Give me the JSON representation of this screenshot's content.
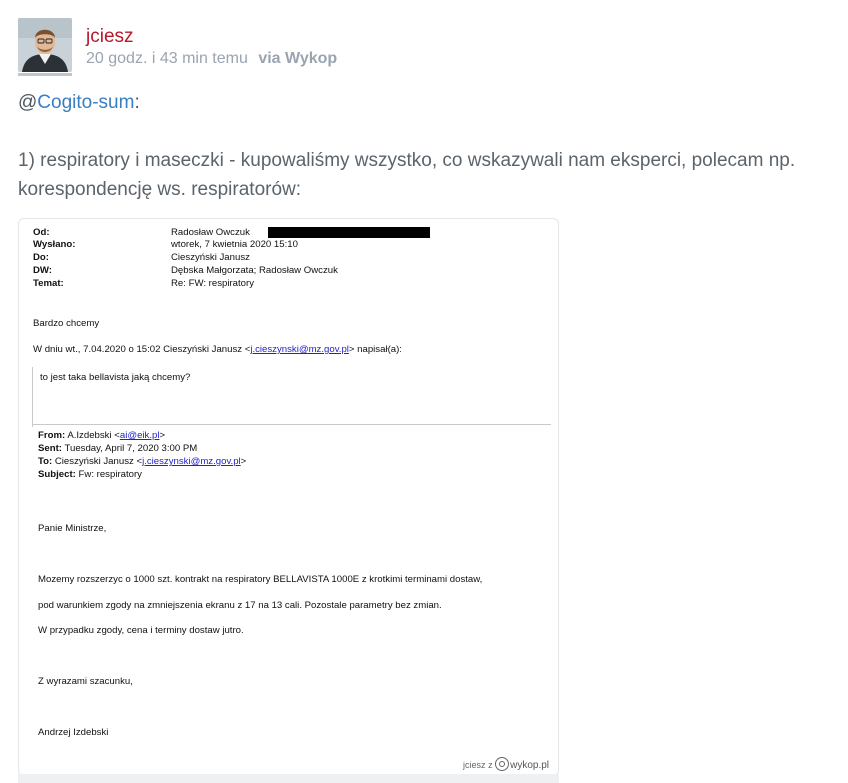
{
  "header": {
    "username": "jciesz",
    "time_ago": "20 godz. i 43 min temu",
    "via_label": "via",
    "via_source": "Wykop"
  },
  "post": {
    "mention_prefix": "@",
    "mention_user": "Cogito-sum",
    "mention_suffix": ":",
    "text": "1) respiratory i maseczki - kupowaliśmy wszystko, co wskazywali nam eksperci, polecam np. korespondencję ws. respiratorów:"
  },
  "email": {
    "headers": [
      {
        "label": "Od:",
        "value": "Radosław Owczuk"
      },
      {
        "label": "Wysłano:",
        "value": "wtorek, 7 kwietnia 2020 15:10"
      },
      {
        "label": "Do:",
        "value": "Cieszyński Janusz"
      },
      {
        "label": "DW:",
        "value": "Dębska Małgorzata; Radosław Owczuk"
      },
      {
        "label": "Temat:",
        "value": "Re: FW: respiratory"
      }
    ],
    "reply": "Bardzo chcemy",
    "quote_intro_prefix": "W dniu wt., 7.04.2020 o 15:02 Cieszyński Janusz <",
    "quote_intro_email": "j.cieszynski@mz.gov.pl",
    "quote_intro_suffix": "> napisał(a):",
    "quoted_text": "to jest taka bellavista jaką chcemy?",
    "forward": {
      "from_label": "From:",
      "from_name": "A.Izdebski <",
      "from_email": "ai@eik.pl",
      "from_close": ">",
      "sent_label": "Sent:",
      "sent_value": "Tuesday, April 7, 2020 3:00 PM",
      "to_label": "To:",
      "to_name": "Cieszyński Janusz <",
      "to_email": "j.cieszynski@mz.gov.pl",
      "to_close": ">",
      "subject_label": "Subject:",
      "subject_value": "Fw: respiratory"
    },
    "body": {
      "salutation": "Panie Ministrze,",
      "line1": "Mozemy rozszerzyc o 1000 szt. kontrakt na respiratory BELLAVISTA 1000E z krotkimi terminami dostaw,",
      "line2": "pod warunkiem zgody na zmniejszenia ekranu z 17 na 13 cali. Pozostale parametry bez zmian.",
      "line3": "W przypadku zgody, cena i terminy dostaw jutro.",
      "closing": "Z wyrazami szacunku,",
      "signature": "Andrzej Izdebski"
    },
    "watermark_user": "jciesz",
    "watermark_z": "z",
    "watermark_site": "wykop.pl"
  },
  "icons": {
    "avatar": "user-avatar",
    "wykop_logo": "wykop-logo-icon"
  },
  "colors": {
    "username": "#b7192b",
    "mention": "#3b7ec0",
    "meta": "#9aa4b0",
    "text": "#5b636b"
  }
}
